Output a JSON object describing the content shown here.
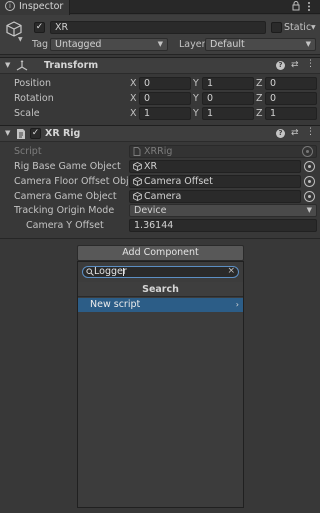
{
  "window": {
    "tab_label": "Inspector",
    "lock_icon": "lock-icon",
    "menu_icon": "kebab-menu-icon"
  },
  "gameobject": {
    "name": "XR",
    "active_checked": true,
    "static_label": "Static",
    "tag_label": "Tag",
    "tag_value": "Untagged",
    "layer_label": "Layer",
    "layer_value": "Default"
  },
  "transform": {
    "title": "Transform",
    "rows": [
      {
        "label": "Position",
        "x": "0",
        "y": "1",
        "z": "0"
      },
      {
        "label": "Rotation",
        "x": "0",
        "y": "0",
        "z": "0"
      },
      {
        "label": "Scale",
        "x": "1",
        "y": "1",
        "z": "1"
      }
    ],
    "axis": {
      "x": "X",
      "y": "Y",
      "z": "Z"
    }
  },
  "xrrig": {
    "title": "XR Rig",
    "enabled": true,
    "script_label": "Script",
    "script_value": "XRRig",
    "rig_base_label": "Rig Base Game Object",
    "rig_base_value": "XR",
    "camera_floor_label": "Camera Floor Offset Object",
    "camera_floor_value": "Camera Offset",
    "camera_go_label": "Camera Game Object",
    "camera_go_value": "Camera",
    "tracking_label": "Tracking Origin Mode",
    "tracking_value": "Device",
    "camera_y_label": "Camera Y Offset",
    "camera_y_value": "1.36144"
  },
  "add_component": {
    "button_label": "Add Component",
    "search_value": "Logger",
    "search_header": "Search",
    "items": [
      {
        "label": "New script",
        "selected": true
      }
    ]
  },
  "colors": {
    "bg": "#383838",
    "header": "#3e3e3e",
    "field": "#2a2a2a",
    "selected": "#2c5d87",
    "popup": "#3c3c3c"
  }
}
